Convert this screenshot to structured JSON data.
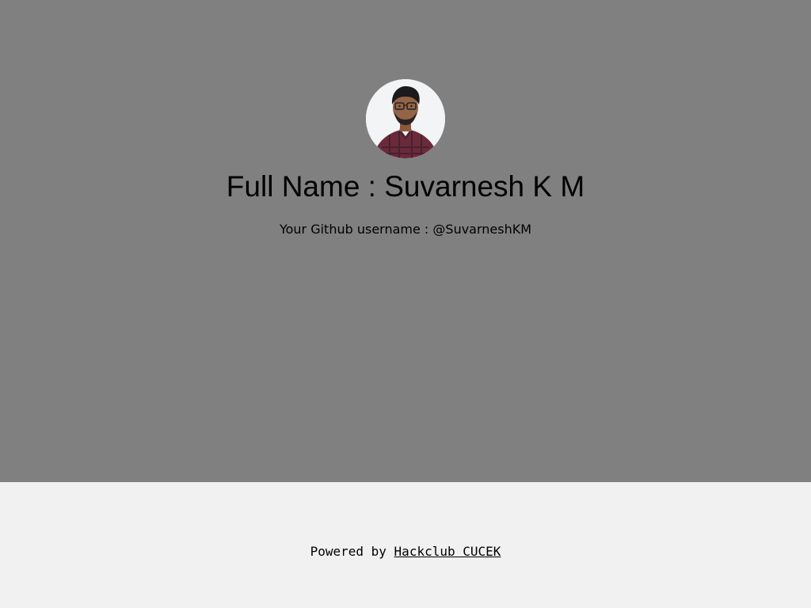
{
  "profile": {
    "full_name": "Full Name : Suvarnesh K M",
    "github_line": "Your Github username : @SuvarneshKM",
    "avatar_icon": "profile-photo"
  },
  "footer": {
    "powered_by": "Powered by",
    "link_text": "Hackclub CUCEK"
  },
  "colors": {
    "hero_background": "#808080",
    "footer_background": "#f1f1f1",
    "text": "#000000"
  }
}
